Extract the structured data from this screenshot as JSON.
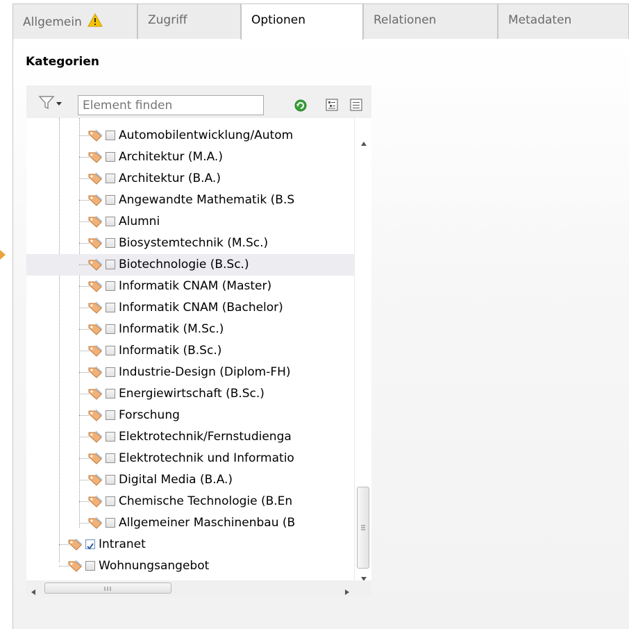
{
  "tabs": [
    {
      "label": "Allgemein",
      "warning": true,
      "active": false
    },
    {
      "label": "Zugriff",
      "warning": false,
      "active": false
    },
    {
      "label": "Optionen",
      "warning": false,
      "active": true
    },
    {
      "label": "Relationen",
      "warning": false,
      "active": false
    },
    {
      "label": "Metadaten",
      "warning": false,
      "active": false
    }
  ],
  "section": {
    "title": "Kategorien"
  },
  "toolbar": {
    "filter_icon": "funnel-icon",
    "search_placeholder": "Element finden",
    "refresh_icon": "refresh-icon",
    "expand_icon": "expand-all-icon",
    "collapse_icon": "collapse-all-icon"
  },
  "tree": {
    "items": [
      {
        "label": "Automobilentwicklung/Autom",
        "level": 2,
        "checked": false,
        "highlighted": false
      },
      {
        "label": "Architektur (M.A.)",
        "level": 2,
        "checked": false,
        "highlighted": false
      },
      {
        "label": "Architektur (B.A.)",
        "level": 2,
        "checked": false,
        "highlighted": false
      },
      {
        "label": "Angewandte Mathematik (B.S",
        "level": 2,
        "checked": false,
        "highlighted": false
      },
      {
        "label": "Alumni",
        "level": 2,
        "checked": false,
        "highlighted": false
      },
      {
        "label": "Biosystemtechnik (M.Sc.)",
        "level": 2,
        "checked": false,
        "highlighted": false
      },
      {
        "label": "Biotechnologie (B.Sc.)",
        "level": 2,
        "checked": false,
        "highlighted": true
      },
      {
        "label": "Informatik CNAM (Master)",
        "level": 2,
        "checked": false,
        "highlighted": false
      },
      {
        "label": "Informatik CNAM (Bachelor)",
        "level": 2,
        "checked": false,
        "highlighted": false
      },
      {
        "label": "Informatik (M.Sc.)",
        "level": 2,
        "checked": false,
        "highlighted": false
      },
      {
        "label": "Informatik (B.Sc.)",
        "level": 2,
        "checked": false,
        "highlighted": false
      },
      {
        "label": "Industrie-Design (Diplom-FH)",
        "level": 2,
        "checked": false,
        "highlighted": false
      },
      {
        "label": "Energiewirtschaft (B.Sc.)",
        "level": 2,
        "checked": false,
        "highlighted": false
      },
      {
        "label": "Forschung",
        "level": 2,
        "checked": false,
        "highlighted": false
      },
      {
        "label": "Elektrotechnik/Fernstudienga",
        "level": 2,
        "checked": false,
        "highlighted": false
      },
      {
        "label": "Elektrotechnik und Informatio",
        "level": 2,
        "checked": false,
        "highlighted": false
      },
      {
        "label": "Digital Media (B.A.)",
        "level": 2,
        "checked": false,
        "highlighted": false
      },
      {
        "label": "Chemische Technologie (B.En",
        "level": 2,
        "checked": false,
        "highlighted": false
      },
      {
        "label": "Allgemeiner Maschinenbau (B",
        "level": 2,
        "checked": false,
        "highlighted": false
      },
      {
        "label": "Intranet",
        "level": 1,
        "checked": true,
        "highlighted": false
      },
      {
        "label": "Wohnungsangebot",
        "level": 1,
        "checked": false,
        "highlighted": false
      }
    ]
  },
  "colors": {
    "warning": "#f5c400",
    "refresh": "#3aa13a",
    "tag": "#f0b27a",
    "checkmark": "#2a5aa8",
    "marker": "#e8a33a"
  }
}
